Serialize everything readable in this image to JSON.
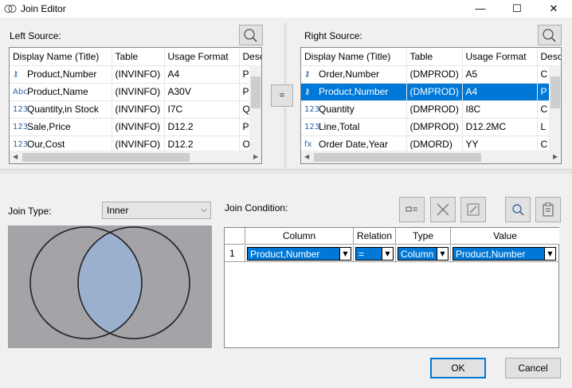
{
  "window": {
    "title": "Join Editor",
    "minimize": "—",
    "maximize": "☐",
    "close": "✕"
  },
  "left_source": {
    "label": "Left Source:",
    "columns": [
      "Display Name (Title)",
      "Table",
      "Usage Format",
      "Descr"
    ],
    "rows": [
      {
        "icon": "key-icon",
        "glyph": "⚷",
        "name": "Product,Number",
        "table": "(INVINFO)",
        "format": "A4",
        "desc": "Pr"
      },
      {
        "icon": "abc-icon",
        "glyph": "Abc",
        "name": "Product,Name",
        "table": "(INVINFO)",
        "format": "A30V",
        "desc": "Pr"
      },
      {
        "icon": "numeric-icon",
        "glyph": "123",
        "name": "Quantity,in Stock",
        "table": "(INVINFO)",
        "format": "I7C",
        "desc": "Q"
      },
      {
        "icon": "numeric-icon",
        "glyph": "123",
        "name": "Sale,Price",
        "table": "(INVINFO)",
        "format": "D12.2",
        "desc": "Pr"
      },
      {
        "icon": "numeric-icon",
        "glyph": "123",
        "name": "Our,Cost",
        "table": "(INVINFO)",
        "format": "D12.2",
        "desc": "O"
      }
    ]
  },
  "right_source": {
    "label": "Right Source:",
    "columns": [
      "Display Name (Title)",
      "Table",
      "Usage Format",
      "Desc"
    ],
    "rows": [
      {
        "icon": "key-icon",
        "glyph": "⚷",
        "name": "Order,Number",
        "table": "(DMPROD)",
        "format": "A5",
        "desc": "C"
      },
      {
        "icon": "key-icon",
        "glyph": "⚷",
        "name": "Product,Number",
        "table": "(DMPROD)",
        "format": "A4",
        "desc": "P"
      },
      {
        "icon": "numeric-icon",
        "glyph": "123",
        "name": "Quantity",
        "table": "(DMPROD)",
        "format": "I8C",
        "desc": "C"
      },
      {
        "icon": "numeric-icon",
        "glyph": "123",
        "name": "Line,Total",
        "table": "(DMPROD)",
        "format": "D12.2MC",
        "desc": "L"
      },
      {
        "icon": "formula-icon",
        "glyph": "fx",
        "name": "Order Date,Year",
        "table": "(DMORD)",
        "format": "YY",
        "desc": "C"
      }
    ],
    "selected_index": 1
  },
  "equals_button": "=",
  "join_type": {
    "label": "Join Type:",
    "value": "Inner"
  },
  "join_condition": {
    "label": "Join Condition:",
    "columns": [
      "Column",
      "Relation",
      "Type",
      "Value"
    ],
    "rows": [
      {
        "num": "1",
        "column": "Product,Number",
        "relation": "=",
        "type": "Column",
        "value": "Product,Number"
      }
    ]
  },
  "buttons": {
    "ok": "OK",
    "cancel": "Cancel"
  },
  "colors": {
    "selection": "#0078d7",
    "venn_background": "#a3a3a8",
    "venn_intersection": "#9bb0cf"
  }
}
